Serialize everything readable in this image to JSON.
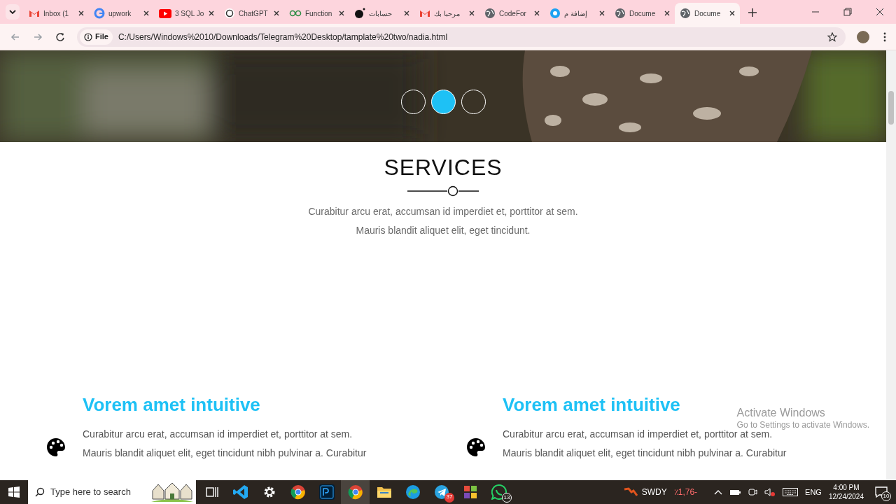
{
  "tabs": [
    {
      "title": "Inbox (1",
      "selected": false
    },
    {
      "title": "upwork",
      "selected": false
    },
    {
      "title": "3 SQL Jo",
      "selected": false
    },
    {
      "title": "ChatGPT",
      "selected": false
    },
    {
      "title": "Function",
      "selected": false
    },
    {
      "title": "حسابات",
      "selected": false
    },
    {
      "title": "مرحبا بك",
      "selected": false
    },
    {
      "title": "CodeFor",
      "selected": false
    },
    {
      "title": "إضافة م",
      "selected": false
    },
    {
      "title": "Docume",
      "selected": false
    },
    {
      "title": "Docume",
      "selected": true
    }
  ],
  "address_bar": {
    "badge": "File",
    "url": "C:/Users/Windows%2010/Downloads/Telegram%20Desktop/tamplate%20two/nadia.html"
  },
  "carousel": {
    "dots": [
      {
        "selected": false
      },
      {
        "selected": true
      },
      {
        "selected": false
      }
    ]
  },
  "services": {
    "title": "SERVICES",
    "lines": [
      "Curabitur arcu erat, accumsan id imperdiet et, porttitor at sem.",
      "Mauris blandit aliquet elit, eget tincidunt."
    ]
  },
  "cards": [
    {
      "title": "Vorem amet intuitive",
      "lines": [
        "Curabitur arcu erat, accumsan id imperdiet et, porttitor at sem.",
        "Mauris blandit aliquet elit, eget tincidunt nibh pulvinar a. Curabitur"
      ]
    },
    {
      "title": "Vorem amet intuitive",
      "lines": [
        "Curabitur arcu erat, accumsan id imperdiet et, porttitor at sem.",
        "Mauris blandit aliquet elit, eget tincidunt nibh pulvinar a. Curabitur"
      ]
    }
  ],
  "activation": {
    "title": "Activate Windows",
    "hint": "Go to Settings to activate Windows."
  },
  "taskbar": {
    "search_placeholder": "Type here to search",
    "apps": [
      {
        "active": false
      },
      {
        "active": false
      },
      {
        "active": false
      },
      {
        "active": false
      },
      {
        "active": false
      },
      {
        "active": true
      },
      {
        "active": false
      },
      {
        "active": false
      },
      {
        "badge": "37",
        "active": false
      },
      {
        "active": false
      },
      {
        "badge": "13",
        "active": false
      }
    ],
    "stock": {
      "symbol": "SWDY",
      "change": "٪1,76-"
    },
    "language": "ENG",
    "time": "4:00 PM",
    "date": "12/24/2024",
    "notifications": "10"
  }
}
